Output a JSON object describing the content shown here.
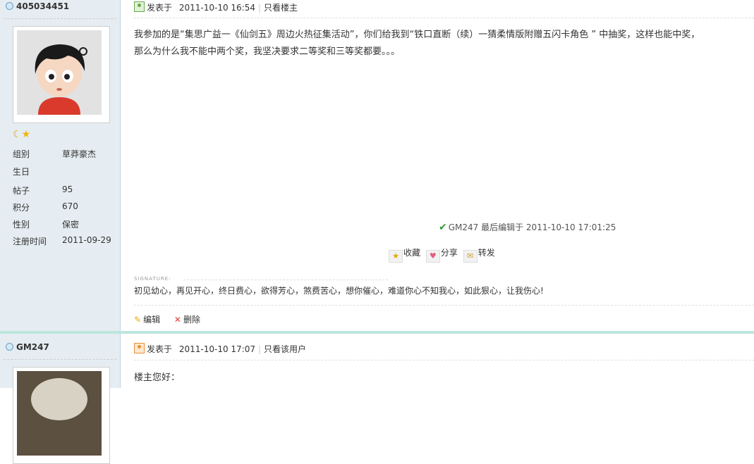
{
  "posts": [
    {
      "author": "405034451",
      "badges": [
        "moon-icon",
        "star-icon"
      ],
      "profile": [
        {
          "key": "组别",
          "value": "草莽豪杰"
        },
        {
          "key": "生日",
          "value": ""
        },
        {
          "key": "帖子",
          "value": "95"
        },
        {
          "key": "积分",
          "value": "670"
        },
        {
          "key": "性别",
          "value": "保密"
        },
        {
          "key": "注册时间",
          "value": "2011-09-29"
        }
      ],
      "posted_label": "发表于",
      "posted_time": "2011-10-10 16:54",
      "filter_link": "只看楼主",
      "body_lines": [
        "我参加的是“集思广益一《仙剑五》周边火热征集活动”，你们给我到“铁口直断（续）一猜柔情版附赠五闪卡角色 ” 中抽奖，这样也能中奖，",
        "那么为什么我不能中两个奖，我坚决要求二等奖和三等奖都要。。。"
      ],
      "edited_note": "GM247 最后编辑于 2011-10-10 17:01:25",
      "actions": {
        "favorite": "收藏",
        "share": "分享",
        "forward": "转发"
      },
      "signature_label": "SIGNATURE:",
      "signature": "初见幼心，再见开心，终日费心，欲得芳心，煞费苦心，想你催心，难道你心不知我心，如此狠心，让我伤心!",
      "footer": {
        "edit": "编辑",
        "delete": "删除"
      }
    },
    {
      "author": "GM247",
      "posted_label": "发表于",
      "posted_time": "2011-10-10 17:07",
      "filter_link": "只看该用户",
      "body_lines": [
        "楼主您好："
      ]
    }
  ]
}
